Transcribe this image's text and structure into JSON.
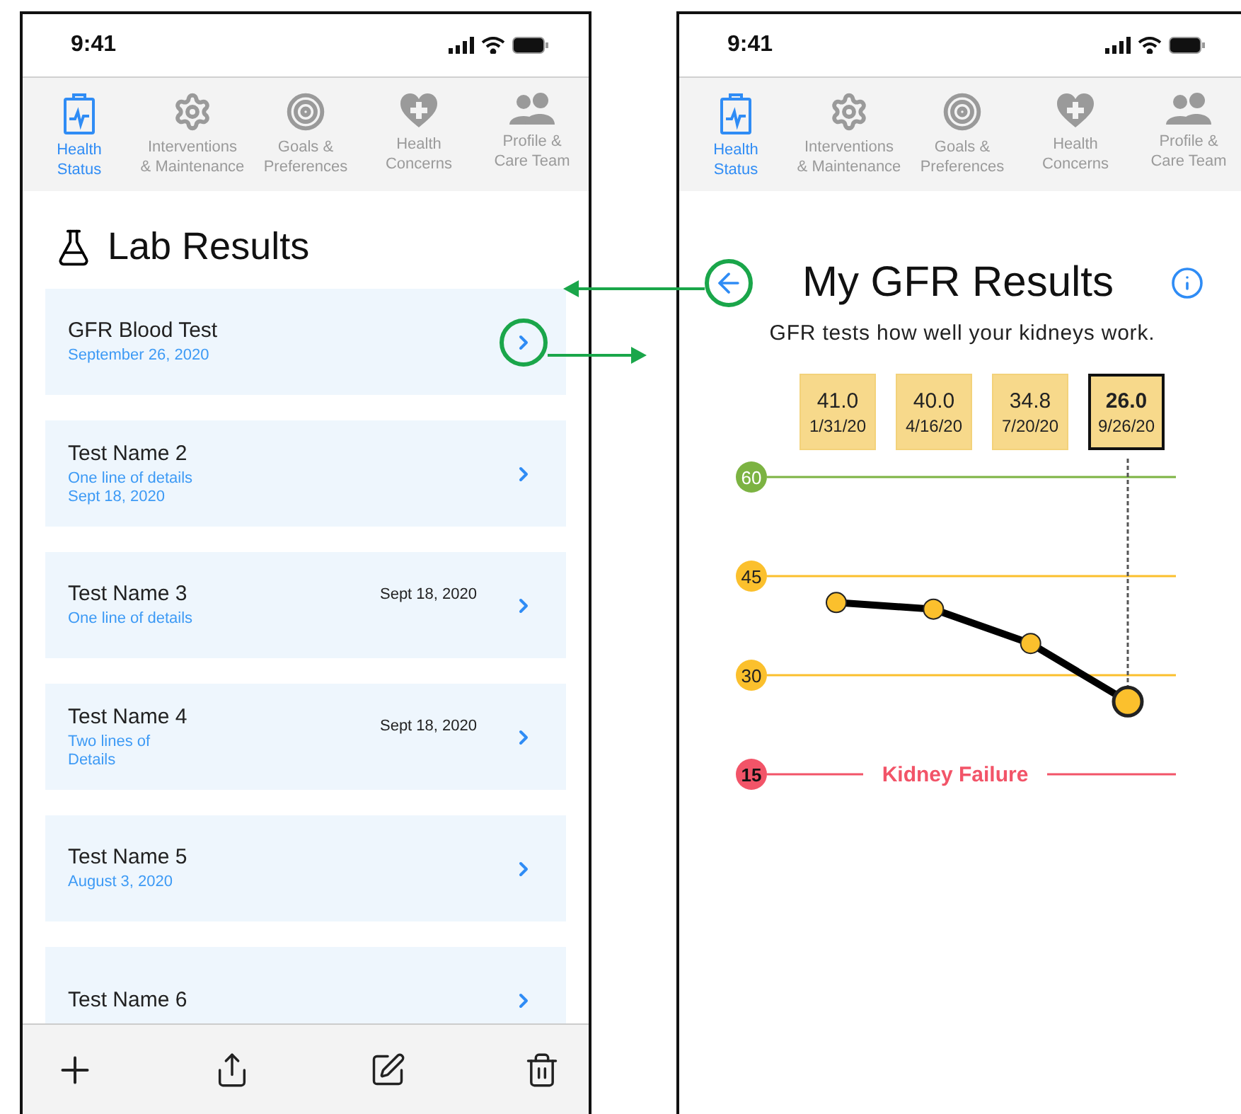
{
  "left_screen": {
    "status_bar": {
      "time": "9:41"
    },
    "tabs": [
      {
        "label": "Health\nStatus",
        "selected": true,
        "kind": "health"
      },
      {
        "label": "Interventions\n& Maintenance",
        "selected": false,
        "kind": "gear"
      },
      {
        "label": "Goals &\nPreferences",
        "selected": false,
        "kind": "target"
      },
      {
        "label": "Health\nConcerns",
        "selected": false,
        "kind": "heart"
      },
      {
        "label": "Profile &\nCare Team",
        "selected": false,
        "kind": "people"
      }
    ],
    "title": "Lab Results",
    "results": [
      {
        "name": "GFR Blood Test",
        "details": [
          "September 26, 2020"
        ],
        "highlighted": true
      },
      {
        "name": "Test Name 2",
        "details": [
          "One line of details",
          "Sept 18, 2020"
        ],
        "highlighted": false
      },
      {
        "name": "Test Name 3",
        "details": [
          "One line of details"
        ],
        "date": "Sept 18, 2020",
        "highlighted": false
      },
      {
        "name": "Test Name 4",
        "details": [
          "Two lines of",
          "Details"
        ],
        "date": "Sept 18, 2020",
        "highlighted": false
      },
      {
        "name": "Test Name 5",
        "details": [
          "August 3, 2020"
        ],
        "highlighted": false
      },
      {
        "name": "Test Name 6",
        "highlighted": false
      }
    ],
    "toolbar": [
      {
        "kind": "add"
      },
      {
        "kind": "share"
      },
      {
        "kind": "edit"
      },
      {
        "kind": "delete"
      }
    ]
  },
  "right_screen": {
    "status_bar": {
      "time": "9:41"
    },
    "tabs": [
      {
        "label": "Health\nStatus",
        "selected": true,
        "kind": "health"
      },
      {
        "label": "Interventions\n& Maintenance",
        "selected": false,
        "kind": "gear"
      },
      {
        "label": "Goals &\nPreferences",
        "selected": false,
        "kind": "target"
      },
      {
        "label": "Health\nConcerns",
        "selected": false,
        "kind": "heart"
      },
      {
        "label": "Profile &\nCare Team",
        "selected": false,
        "kind": "people"
      }
    ],
    "title": "My GFR Results",
    "back_highlighted": true,
    "subtitle": "GFR tests how well your kidneys work.",
    "readings": [
      {
        "value": "41.0",
        "date": "1/31/20",
        "selected": false
      },
      {
        "value": "40.0",
        "date": "4/16/20",
        "selected": false
      },
      {
        "value": "34.8",
        "date": "7/20/20",
        "selected": false
      },
      {
        "value": "26.0",
        "date": "9/26/20",
        "selected": true
      }
    ],
    "chart_data": {
      "type": "line",
      "series": [
        {
          "color": "#000000",
          "marker": "circle",
          "values": [
            41.0,
            40.0,
            34.8,
            26.0
          ]
        }
      ],
      "ylim": [
        15,
        60
      ],
      "yticks": [
        {
          "value": 60,
          "label": "60"
        },
        {
          "value": 45,
          "label": "45"
        },
        {
          "value": 30,
          "label": "30"
        },
        {
          "value": 15,
          "label": "15"
        }
      ],
      "ref_lines": [
        {
          "color": "#7cb342"
        },
        {
          "color": "#fbc02d"
        },
        {
          "color": "#fbc02d"
        },
        {
          "color": "#f25468",
          "label": "Kidney Failure"
        }
      ]
    }
  }
}
